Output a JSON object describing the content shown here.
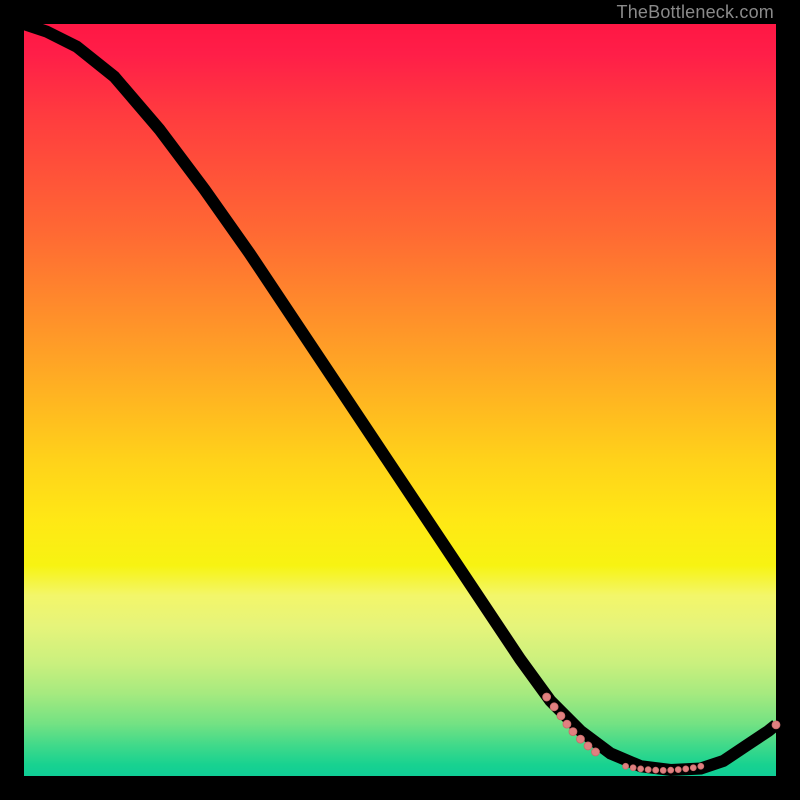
{
  "watermark": "TheBottleneck.com",
  "colors": {
    "gradient_top": "#ff1744",
    "gradient_mid": "#ffd21a",
    "gradient_bottom": "#0fcd96",
    "curve": "#000000",
    "dot_fill": "#e08080",
    "dot_stroke": "#c86a6a",
    "background": "#000000"
  },
  "chart_data": {
    "type": "line",
    "title": "",
    "xlabel": "",
    "ylabel": "",
    "xlim": [
      0,
      100
    ],
    "ylim": [
      0,
      100
    ],
    "curve_points": [
      {
        "x": 0,
        "y": 100.0
      },
      {
        "x": 3,
        "y": 99.0
      },
      {
        "x": 7,
        "y": 97.0
      },
      {
        "x": 12,
        "y": 93.0
      },
      {
        "x": 18,
        "y": 86.0
      },
      {
        "x": 24,
        "y": 78.0
      },
      {
        "x": 30,
        "y": 69.5
      },
      {
        "x": 36,
        "y": 60.5
      },
      {
        "x": 42,
        "y": 51.5
      },
      {
        "x": 48,
        "y": 42.5
      },
      {
        "x": 54,
        "y": 33.5
      },
      {
        "x": 60,
        "y": 24.5
      },
      {
        "x": 66,
        "y": 15.5
      },
      {
        "x": 70,
        "y": 10.0
      },
      {
        "x": 74,
        "y": 6.0
      },
      {
        "x": 78,
        "y": 3.0
      },
      {
        "x": 82,
        "y": 1.3
      },
      {
        "x": 86,
        "y": 0.8
      },
      {
        "x": 90,
        "y": 1.0
      },
      {
        "x": 93,
        "y": 2.0
      },
      {
        "x": 96,
        "y": 4.0
      },
      {
        "x": 99,
        "y": 6.0
      },
      {
        "x": 100,
        "y": 6.8
      }
    ],
    "dots": [
      {
        "x": 69.5,
        "y": 10.5,
        "r": 4
      },
      {
        "x": 70.5,
        "y": 9.2,
        "r": 4
      },
      {
        "x": 71.4,
        "y": 8.0,
        "r": 4
      },
      {
        "x": 72.2,
        "y": 6.9,
        "r": 4
      },
      {
        "x": 73.0,
        "y": 5.9,
        "r": 4
      },
      {
        "x": 74.0,
        "y": 4.9,
        "r": 4
      },
      {
        "x": 75.0,
        "y": 4.0,
        "r": 4
      },
      {
        "x": 76.0,
        "y": 3.2,
        "r": 4
      },
      {
        "x": 80.0,
        "y": 1.3,
        "r": 3
      },
      {
        "x": 81.0,
        "y": 1.1,
        "r": 3
      },
      {
        "x": 82.0,
        "y": 0.95,
        "r": 3
      },
      {
        "x": 83.0,
        "y": 0.85,
        "r": 3
      },
      {
        "x": 84.0,
        "y": 0.78,
        "r": 3
      },
      {
        "x": 85.0,
        "y": 0.75,
        "r": 3
      },
      {
        "x": 86.0,
        "y": 0.78,
        "r": 3
      },
      {
        "x": 87.0,
        "y": 0.85,
        "r": 3
      },
      {
        "x": 88.0,
        "y": 0.95,
        "r": 3
      },
      {
        "x": 89.0,
        "y": 1.1,
        "r": 3
      },
      {
        "x": 90.0,
        "y": 1.3,
        "r": 3
      },
      {
        "x": 100.0,
        "y": 6.8,
        "r": 4
      }
    ]
  }
}
